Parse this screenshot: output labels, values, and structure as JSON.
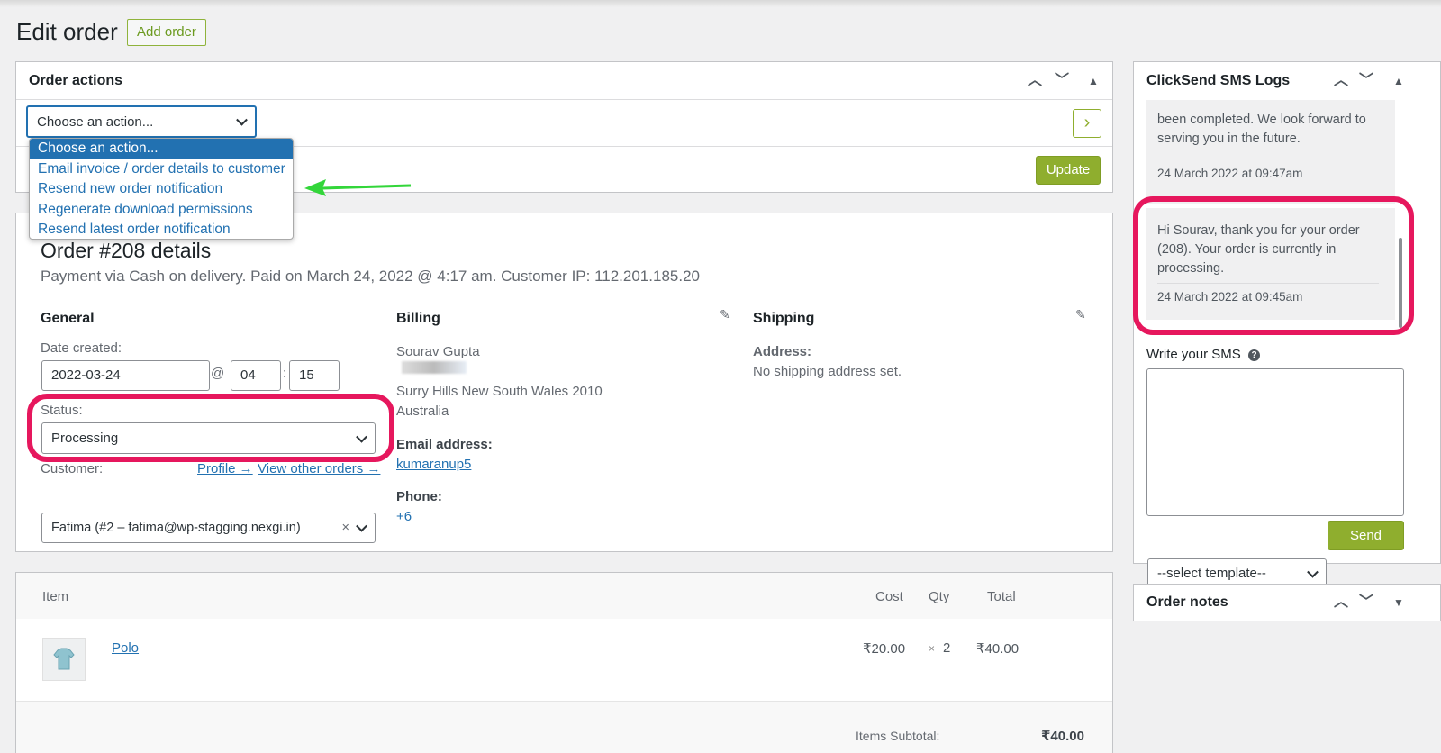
{
  "page": {
    "title": "Edit order",
    "add_order_label": "Add order"
  },
  "order_actions": {
    "title": "Order actions",
    "select_value": "Choose an action...",
    "options": [
      "Choose an action...",
      "Email invoice / order details to customer",
      "Resend new order notification",
      "Regenerate download permissions",
      "Resend latest order notification"
    ],
    "go_label": "›",
    "update_label": "Update"
  },
  "order": {
    "heading": "Order #208 details",
    "meta": "Payment via Cash on delivery. Paid on March 24, 2022 @ 4:17 am. Customer IP: 112.201.185.20",
    "general": {
      "title": "General",
      "date_label": "Date created:",
      "date": "2022-03-24",
      "at": "@",
      "hour": "04",
      "colon": ":",
      "minute": "15",
      "status_label": "Status:",
      "status": "Processing",
      "customer_label": "Customer:",
      "profile_link": "Profile →",
      "other_orders_link": "View other orders →",
      "customer": "Fatima (#2 – fatima@wp-stagging.nexgi.in)",
      "clear": "×"
    },
    "billing": {
      "title": "Billing",
      "name": "Sourav Gupta",
      "city": "Surry Hills New South Wales 2010",
      "country": "Australia",
      "email_label": "Email address:",
      "email": "kumaranup5",
      "phone_label": "Phone:",
      "phone": "+6"
    },
    "shipping": {
      "title": "Shipping",
      "address_label": "Address:",
      "address": "No shipping address set."
    }
  },
  "items": {
    "headers": {
      "item": "Item",
      "cost": "Cost",
      "qty": "Qty",
      "total": "Total"
    },
    "rows": [
      {
        "name": "Polo",
        "cost": "₹20.00",
        "qty_x": "×",
        "qty": "2",
        "total": "₹40.00"
      }
    ],
    "subtotal_label": "Items Subtotal:",
    "subtotal": "₹40.00"
  },
  "sms_logs": {
    "title": "ClickSend SMS Logs",
    "partial_msg": "been completed. We look forward to serving you in the future.",
    "partial_date": "24 March 2022 at 09:47am",
    "msg": "Hi Sourav, thank you for your order (208). Your order is currently in processing.",
    "msg_date": "24 March 2022 at 09:45am",
    "write_label": "Write your SMS",
    "help": "?",
    "template_value": "--select template--",
    "send_label": "Send"
  },
  "order_notes": {
    "title": "Order notes"
  },
  "colors": {
    "accent_green": "#8fae2e",
    "highlight": "#e6175d",
    "link": "#2271b1",
    "arrow": "#33d63a"
  }
}
